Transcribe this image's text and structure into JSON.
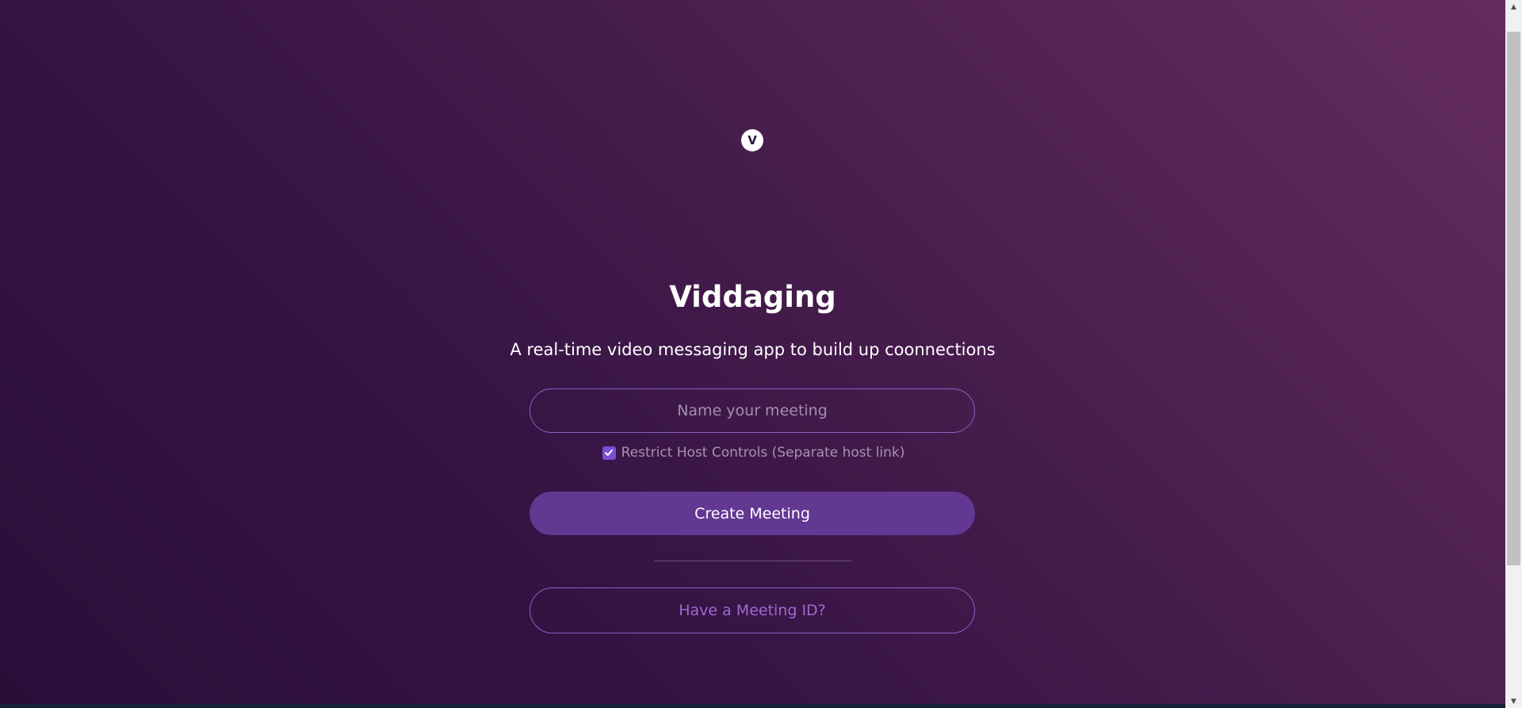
{
  "app": {
    "logo_letter": "V",
    "title": "Viddaging",
    "tagline": "A real-time video messaging app to build up coonnections"
  },
  "form": {
    "meeting_name": {
      "value": "",
      "placeholder": "Name your meeting"
    },
    "restrict_host": {
      "checked": true,
      "label": "Restrict Host Controls (Separate host link)"
    },
    "create_label": "Create Meeting",
    "meeting_id_label": "Have a Meeting ID?"
  },
  "scrollbar": {
    "up_icon": "▲",
    "down_icon": "▼"
  },
  "colors": {
    "accent": "#623892",
    "link": "#9d6ad4",
    "border": "#8a5fc7",
    "checkbox": "#7a4fd4"
  }
}
